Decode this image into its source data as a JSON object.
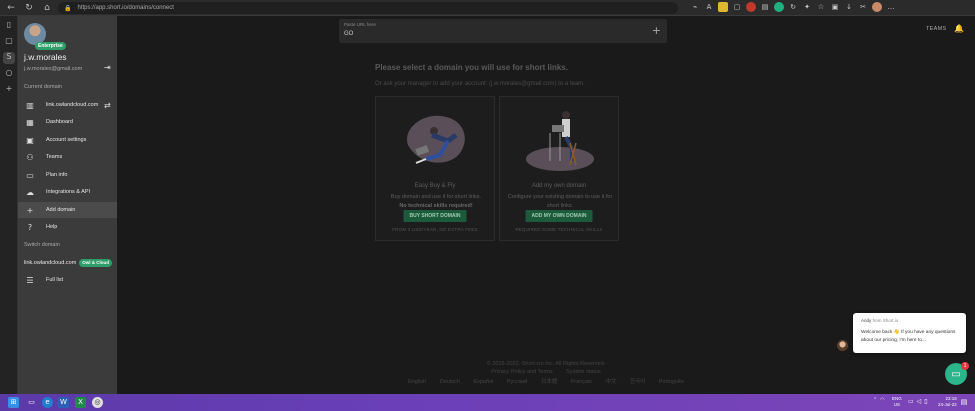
{
  "browser": {
    "url": "https://app.short.io/domains/connect",
    "rail_icons": [
      "sidebar-toggle-icon",
      "tabs-icon",
      "shortio-icon",
      "circle-icon",
      "plus-icon"
    ]
  },
  "sidebar": {
    "plan_badge": "Enterprise",
    "user_name": "j.w.morales",
    "user_email": "j.w.morales@gmail.com",
    "current_domain_label": "Current domain",
    "current_domain": "link.owlandcloud.com",
    "items": [
      {
        "label": "Dashboard",
        "icon": "▦"
      },
      {
        "label": "Account settings",
        "icon": "▣"
      },
      {
        "label": "Teams",
        "icon": "👥"
      },
      {
        "label": "Plan info",
        "icon": "▭"
      },
      {
        "label": "Integrations & API",
        "icon": "☁"
      },
      {
        "label": "Add domain",
        "icon": "+"
      },
      {
        "label": "Help",
        "icon": "?"
      }
    ],
    "switch_domain_label": "Switch domain",
    "switch_domain": "link.owlandcloud.com",
    "switch_badge": "Owl & Cloud",
    "full_list": "Full list"
  },
  "header": {
    "paste_label": "Paste URL here",
    "paste_value": "GO",
    "teams": "TEAMS"
  },
  "main": {
    "headline": "Please select a domain you will use for short links.",
    "subline": "Or ask your manager to add your account: (j.w.morales@gmail.com) to a team.",
    "cards": [
      {
        "title": "Easy Buy & Fly",
        "desc": "Buy domain and use it for short links.",
        "desc_bold": "No technical skills required!",
        "button": "BUY SHORT DOMAIN",
        "note": "FROM 3 USD/YEAR, NO EXTRA FEES"
      },
      {
        "title": "Add my own domain",
        "desc": "Configure your existing domain to use it for short links.",
        "desc_bold": "",
        "button": "ADD MY OWN DOMAIN",
        "note": "REQUIRED SOME TECHNICAL SKILLS"
      }
    ]
  },
  "footer": {
    "copyright": "© 2015-2022. Short.cm Inc. All Rights Reserved.",
    "links": [
      "Privacy Policy and Terms",
      "System status"
    ],
    "languages": [
      "English",
      "Deutsch",
      "Español",
      "Русский",
      "日本語",
      "Français",
      "中文",
      "한국어",
      "Português"
    ]
  },
  "chat": {
    "agent": "Andy",
    "from_suffix": "from Short.io",
    "message": "Welcome back 👋 If you have any questions about our pricing, I'm here to...",
    "unread": "1"
  },
  "taskbar": {
    "lang_line1": "ENG",
    "lang_line2": "US",
    "time": "23:16",
    "date": "24-Jul-22"
  },
  "colors": {
    "accent": "#2f9e68",
    "sidebar_bg": "#3b3b3b",
    "main_bg": "#1a1a1a",
    "chat_launcher": "#2cb48a"
  }
}
